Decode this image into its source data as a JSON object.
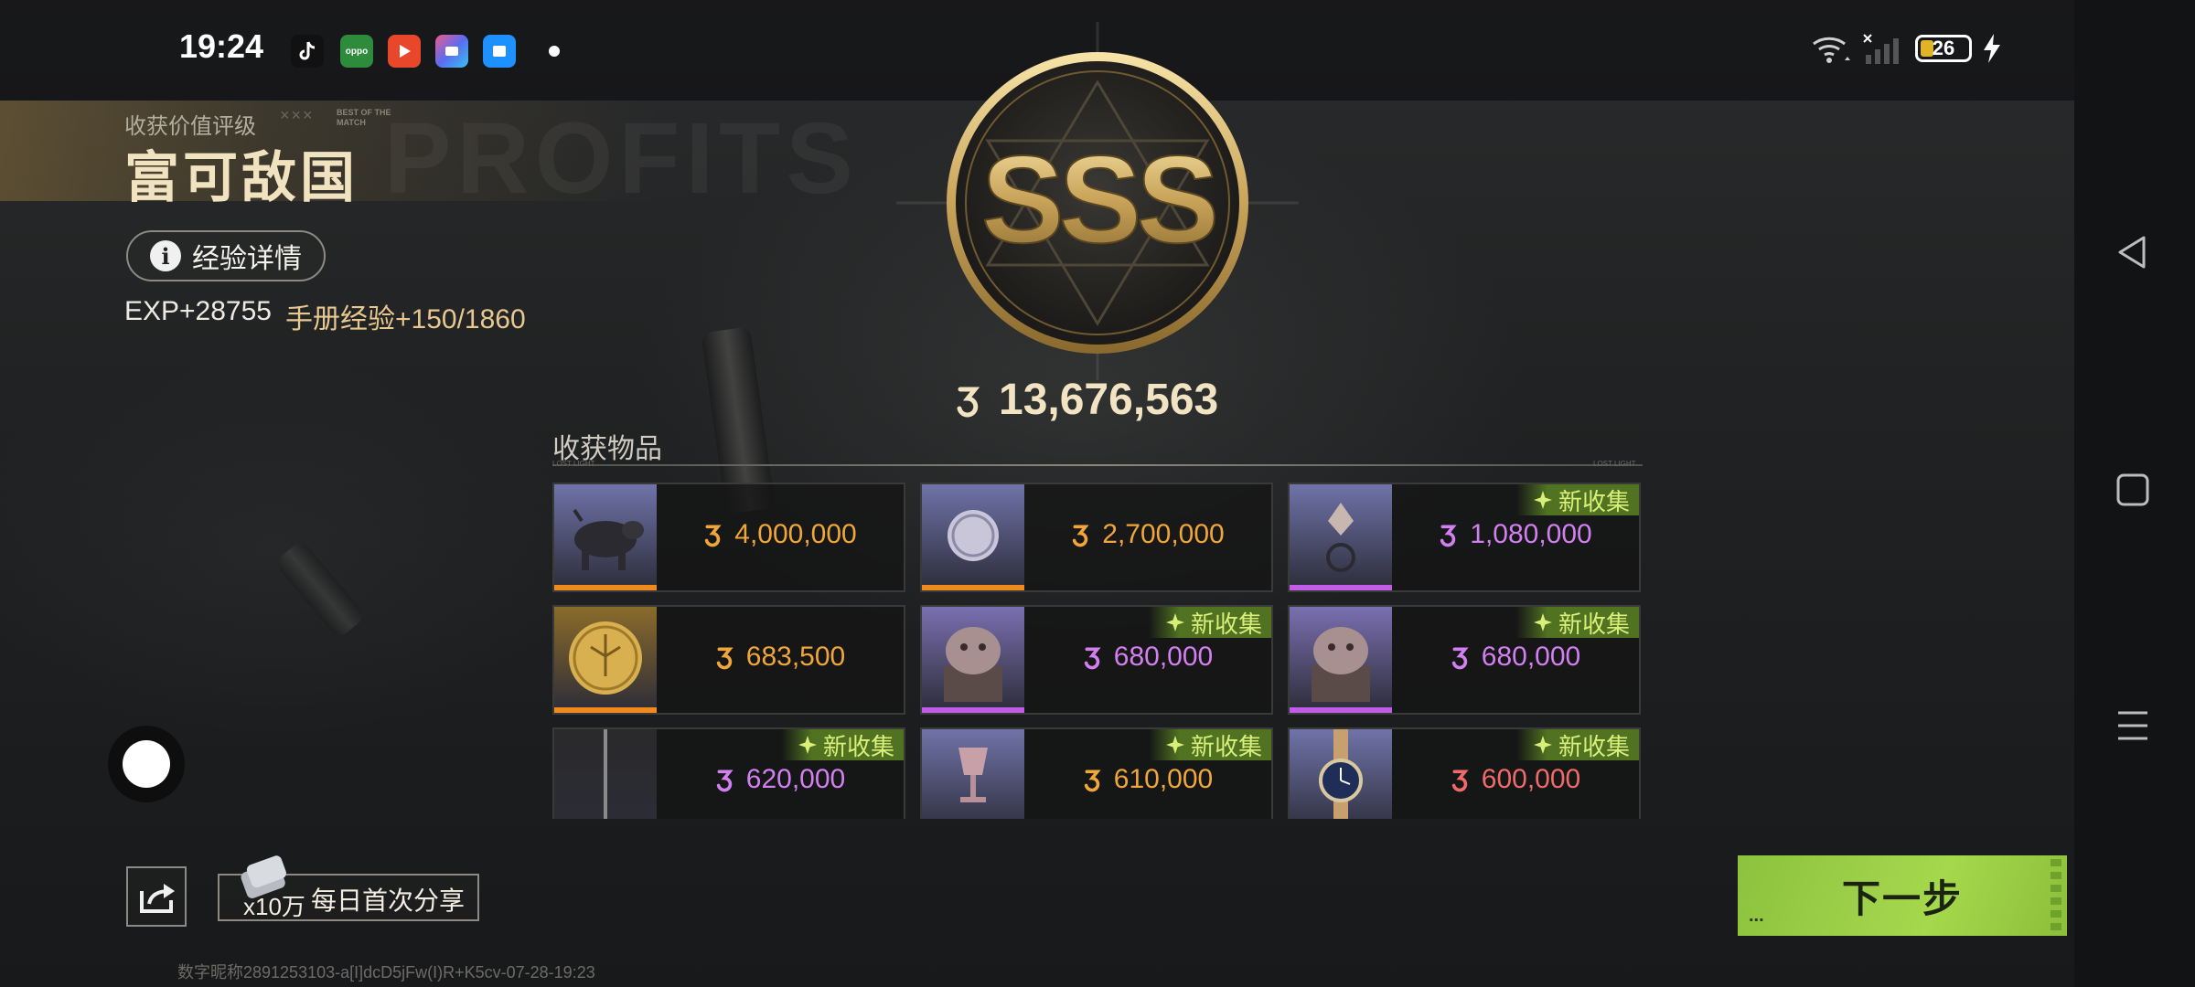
{
  "status_bar": {
    "time": "19:24",
    "apps": [
      {
        "icon": "tiktok-icon",
        "color": "#111111"
      },
      {
        "icon": "oppo-store-icon",
        "color": "#2e8b3c",
        "text": "oppo"
      },
      {
        "icon": "video-player-icon",
        "color": "#e9472b"
      },
      {
        "icon": "gallery-icon",
        "color": "#5b6cf0"
      },
      {
        "icon": "files-icon",
        "color": "#1e90ff"
      }
    ],
    "battery": "26"
  },
  "header": {
    "rating_title": "收获价值评级",
    "best_of_match": "BEST OF THE MATCH",
    "rating_value": "富可敌国",
    "exp_button": "经验详情",
    "exp": "EXP+28755",
    "manual_exp": "手册经验+150/1860"
  },
  "emblem": {
    "grade": "SSS",
    "total_value": "13,676,563"
  },
  "items_section": {
    "title": "收获物品",
    "new_badge": "新收集",
    "items": [
      {
        "name": "pig-statue",
        "value": "4,000,000",
        "value_color": "#f0a63a",
        "rarity_color": "#f08a1c",
        "thumb_bg": "#6f73a8",
        "is_new": false
      },
      {
        "name": "silver-coin",
        "value": "2,700,000",
        "value_color": "#f0a63a",
        "rarity_color": "#f08a1c",
        "thumb_bg": "#6f73a8",
        "is_new": false
      },
      {
        "name": "ring-pendant",
        "value": "1,080,000",
        "value_color": "#d27ff0",
        "rarity_color": "#c15ce8",
        "thumb_bg": "#6f73a8",
        "is_new": true
      },
      {
        "name": "gold-medal",
        "value": "683,500",
        "value_color": "#f0a63a",
        "rarity_color": "#f08a1c",
        "thumb_bg": "#8a6b2a",
        "is_new": false
      },
      {
        "name": "lion-seal",
        "value": "680,000",
        "value_color": "#d27ff0",
        "rarity_color": "#c15ce8",
        "thumb_bg": "#7a6fb0",
        "is_new": true
      },
      {
        "name": "lion-seal-2",
        "value": "680,000",
        "value_color": "#d27ff0",
        "rarity_color": "#c15ce8",
        "thumb_bg": "#7a6fb0",
        "is_new": true
      },
      {
        "name": "sword",
        "value": "620,000",
        "value_color": "#d27ff0",
        "rarity_color": "#c15ce8",
        "thumb_bg": "#2a2a2a",
        "is_new": true
      },
      {
        "name": "trophy",
        "value": "610,000",
        "value_color": "#f0a63a",
        "rarity_color": "#f08a1c",
        "thumb_bg": "#6f73a8",
        "is_new": true
      },
      {
        "name": "wristwatch",
        "value": "600,000",
        "value_color": "#f06a6a",
        "rarity_color": "#e04a4a",
        "thumb_bg": "#6f73a8",
        "is_new": true
      }
    ]
  },
  "share": {
    "amount": "x10万",
    "label": "每日首次分享"
  },
  "next_button": {
    "label": "下一步",
    "dots": "..."
  },
  "watermark": "数字昵称2891253103-a[I]dcD5jFw(I)R+K5cv-07-28-19:23"
}
